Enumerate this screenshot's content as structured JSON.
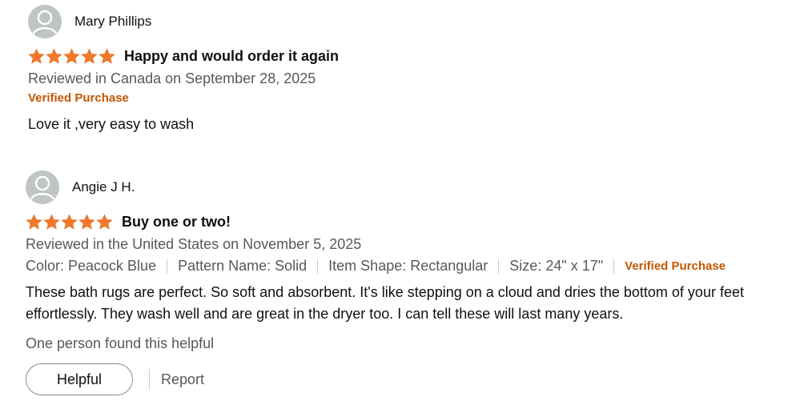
{
  "reviews": [
    {
      "reviewer": "Mary Phillips",
      "rating": 5,
      "title": "Happy and would order it again",
      "review_date": "Reviewed in Canada on September 28, 2025",
      "verified": "Verified Purchase",
      "body": "Love it ,very easy to wash"
    },
    {
      "reviewer": "Angie J H.",
      "rating": 5,
      "title": "Buy one or two!",
      "review_date": "Reviewed in the United States on November 5, 2025",
      "attributes": {
        "color": "Color: Peacock Blue",
        "pattern": "Pattern Name: Solid",
        "shape": "Item Shape: Rectangular",
        "size": "Size: 24\" x 17\""
      },
      "verified": "Verified Purchase",
      "body": "These bath rugs are perfect. So soft and absorbent. It's like stepping on a cloud and dries the bottom of your feet effortlessly. They wash well and are great in the dryer too. I can tell these will last many years.",
      "helpful_count": "One person found this helpful",
      "helpful_label": "Helpful",
      "report_label": "Report"
    }
  ],
  "colors": {
    "star": "#f3782b",
    "verified": "#c45500",
    "avatar": "#bfc4c4"
  },
  "icons": {
    "avatar": "user-avatar-icon",
    "star": "star-icon"
  }
}
